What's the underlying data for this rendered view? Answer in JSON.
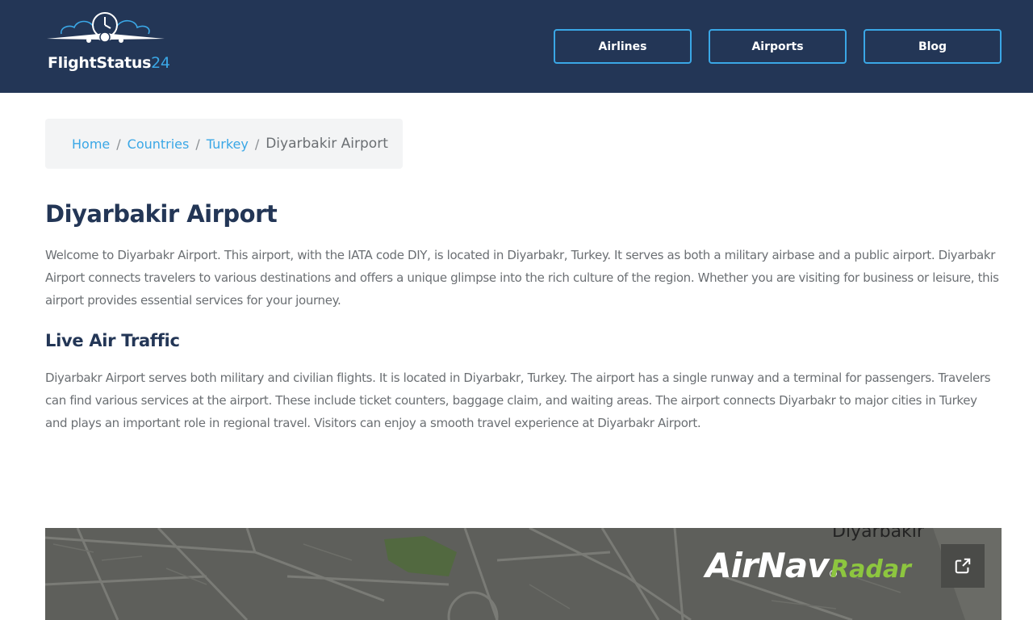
{
  "header": {
    "logo_name": "FlightStatus",
    "logo_accent": "24",
    "nav": [
      {
        "label": "Airlines"
      },
      {
        "label": "Airports"
      },
      {
        "label": "Blog"
      }
    ]
  },
  "breadcrumb": {
    "items": [
      "Home",
      "Countries",
      "Turkey"
    ],
    "separator": "/",
    "current": "Diyarbakir Airport"
  },
  "main": {
    "title": "Diyarbakir Airport",
    "intro": "Welcome to Diyarbakr Airport. This airport, with the IATA code DIY, is located in Diyarbakr, Turkey. It serves as both a military airbase and a public airport. Diyarbakr Airport connects travelers to various destinations and offers a unique glimpse into the rich culture of the region. Whether you are visiting for business or leisure, this airport provides essential services for your journey.",
    "section_title": "Live Air Traffic",
    "section_text": "Diyarbakr Airport serves both military and civilian flights. It is located in Diyarbakr, Turkey. The airport has a single runway and a terminal for passengers. Travelers can find various services at the airport. These include ticket counters, baggage claim, and waiting areas. The airport connects Diyarbakr to major cities in Turkey and plays an important role in regional travel. Visitors can enjoy a smooth travel experience at Diyarbakr Airport."
  },
  "map": {
    "city_label": "Diyarbakir",
    "brand": "AirNav",
    "brand_mark": "®",
    "brand_product": "Radar",
    "icons": [
      "airplane-clock-logo-icon",
      "external-link-icon"
    ]
  },
  "colors": {
    "header_bg": "#233656",
    "accent": "#3aa7e6",
    "title": "#233656",
    "body_text": "#6b6f73",
    "radar_green": "#8dc63f"
  }
}
